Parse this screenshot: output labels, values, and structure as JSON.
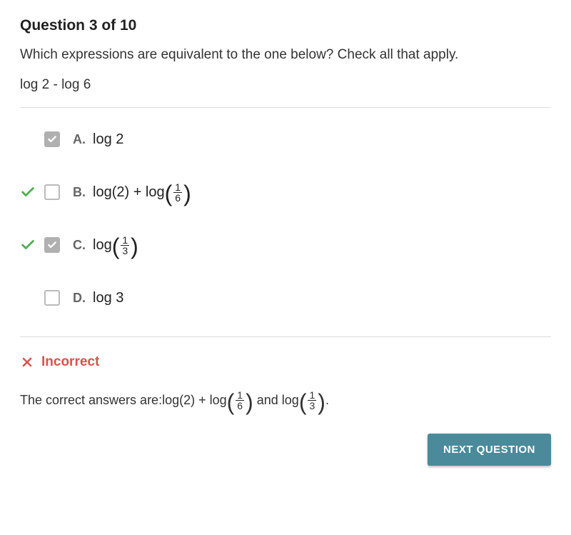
{
  "header": "Question 3 of 10",
  "questionText": "Which expressions are equivalent to the one below? Check all that apply.",
  "expression": "log 2 - log 6",
  "answers": {
    "A": {
      "letter": "A.",
      "text": "log 2",
      "checked": true,
      "correctMark": false
    },
    "B": {
      "letter": "B.",
      "text": "log(2) + log",
      "fracNum": "1",
      "fracDen": "6",
      "checked": false,
      "correctMark": true
    },
    "C": {
      "letter": "C.",
      "text": "log",
      "fracNum": "1",
      "fracDen": "3",
      "checked": true,
      "correctMark": true
    },
    "D": {
      "letter": "D.",
      "text": "log 3",
      "checked": false,
      "correctMark": false
    }
  },
  "result": {
    "status": "Incorrect",
    "prefix": "The correct answers are: ",
    "ans1Text": "log(2) + log",
    "ans1Num": "1",
    "ans1Den": "6",
    "andText": " and ",
    "ans2Text": "log",
    "ans2Num": "1",
    "ans2Den": "3",
    "suffix": "."
  },
  "nextButton": "NEXT QUESTION"
}
